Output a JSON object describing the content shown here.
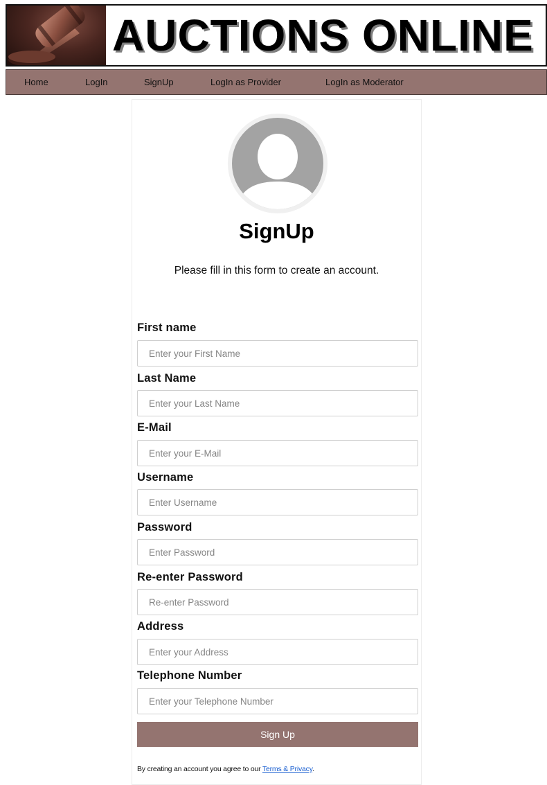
{
  "header": {
    "logo_icon": "gavel-icon",
    "site_title": "AUCTIONS ONLINE"
  },
  "nav": {
    "items": [
      {
        "label": "Home"
      },
      {
        "label": "LogIn"
      },
      {
        "label": "SignUp"
      },
      {
        "label": "LogIn as Provider"
      },
      {
        "label": "LogIn as Moderator"
      }
    ]
  },
  "form": {
    "avatar_icon": "user-avatar-icon",
    "title": "SignUp",
    "subtitle": "Please fill in this form to create an account.",
    "fields": [
      {
        "label": "First name",
        "placeholder": "Enter your First Name",
        "value": ""
      },
      {
        "label": "Last Name",
        "placeholder": "Enter your Last Name",
        "value": ""
      },
      {
        "label": "E-Mail",
        "placeholder": "Enter your E-Mail",
        "value": ""
      },
      {
        "label": "Username",
        "placeholder": "Enter Username",
        "value": ""
      },
      {
        "label": "Password",
        "placeholder": "Enter Password",
        "value": ""
      },
      {
        "label": "Re-enter Password",
        "placeholder": "Re-enter Password",
        "value": ""
      },
      {
        "label": "Address",
        "placeholder": "Enter your Address",
        "value": ""
      },
      {
        "label": "Telephone Number",
        "placeholder": "Enter your Telephone Number",
        "value": ""
      }
    ],
    "submit_label": "Sign Up",
    "terms_prefix": "By creating an account you agree to our ",
    "terms_link": "Terms & Privacy",
    "terms_suffix": "."
  },
  "colors": {
    "accent": "#947470",
    "link": "#1a5fd1"
  }
}
